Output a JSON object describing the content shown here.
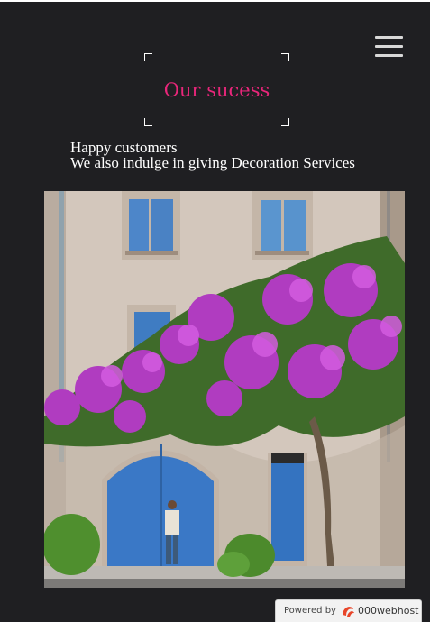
{
  "header": {
    "menu_icon": "hamburger-menu-icon"
  },
  "section": {
    "title": "Our sucess",
    "subtitle_line1": "Happy customers",
    "subtitle_line2": "We also indulge in giving Decoration Services",
    "title_color": "#e8267a"
  },
  "photo": {
    "subject": "house-with-bougainvillea-image"
  },
  "footer_badge": {
    "powered_label": "Powered by",
    "brand": "000webhost",
    "logo_icon": "000webhost-logo-icon"
  },
  "colors": {
    "background": "#1f1f22",
    "accent": "#e8267a",
    "text": "#ffffff"
  }
}
